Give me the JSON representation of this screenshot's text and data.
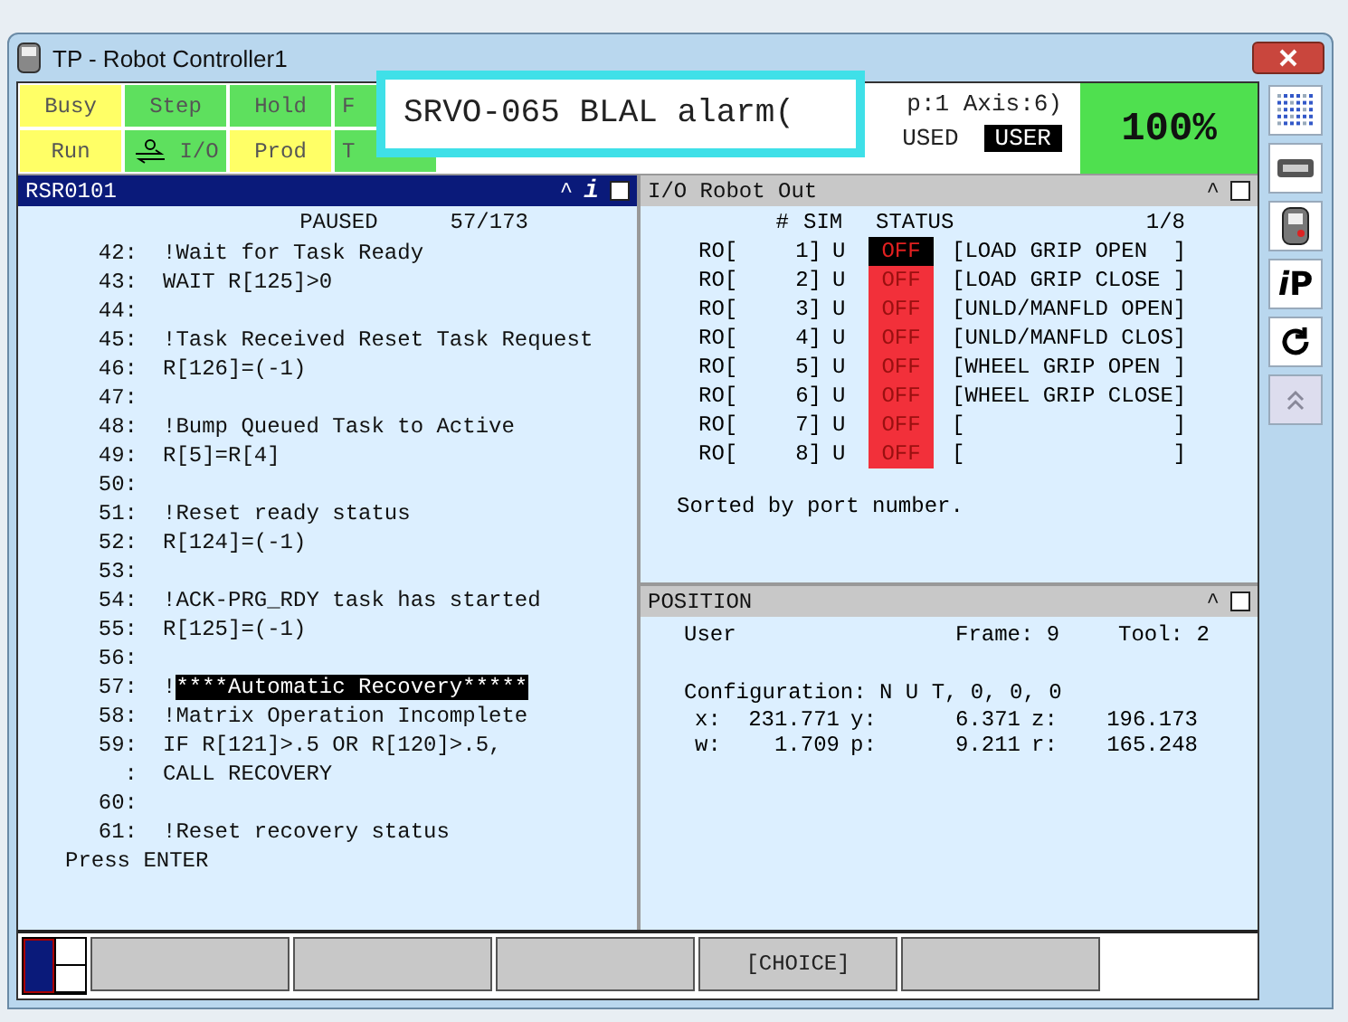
{
  "window": {
    "title": "TP - Robot Controller1"
  },
  "status_keys": [
    {
      "label": "Busy",
      "color": "#ffff66"
    },
    {
      "label": "Step",
      "color": "#5ee05e"
    },
    {
      "label": "Hold",
      "color": "#5ee05e"
    },
    {
      "label": "F",
      "color": "#5ee05e"
    },
    {
      "label": "Run",
      "color": "#ffff66"
    },
    {
      "label": "I/O",
      "color": "#5ee05e",
      "icon": true
    },
    {
      "label": "Prod",
      "color": "#ffff66"
    },
    {
      "label": "T",
      "color": "#5ee05e"
    }
  ],
  "status_info": {
    "line1": "p:1 Axis:6)",
    "line2": "USED",
    "mode": "USER"
  },
  "override": "100%",
  "alarm": "SRVO-065 BLAL alarm(",
  "program": {
    "title": "RSR0101",
    "controls": [
      "^",
      "i"
    ],
    "state": "PAUSED",
    "position": "57/173",
    "lines": [
      {
        "num": "42:",
        "text": "!Wait for Task Ready"
      },
      {
        "num": "43:",
        "text": "WAIT R[125]>0"
      },
      {
        "num": "44:"
      },
      {
        "num": "45:",
        "text": "!Task Received Reset Task Request"
      },
      {
        "num": "46:",
        "text": "R[126]=(-1)"
      },
      {
        "num": "47:"
      },
      {
        "num": "48:",
        "text": "!Bump Queued Task to Active"
      },
      {
        "num": "49:",
        "text": "R[5]=R[4]"
      },
      {
        "num": "50:"
      },
      {
        "num": "51:",
        "text": "!Reset ready status"
      },
      {
        "num": "52:",
        "text": "R[124]=(-1)"
      },
      {
        "num": "53:"
      },
      {
        "num": "54:",
        "text": "!ACK-PRG_RDY task has started"
      },
      {
        "num": "55:",
        "text": "R[125]=(-1)"
      },
      {
        "num": "56:"
      },
      {
        "num": "57:",
        "text": "!",
        "highlight": "****Automatic Recovery*****"
      },
      {
        "num": "58:",
        "text": "!Matrix Operation Incomplete"
      },
      {
        "num": "59:",
        "text": "IF R[121]>.5 OR R[120]>.5,"
      },
      {
        "num": ":",
        "text": "CALL RECOVERY"
      },
      {
        "num": "60:"
      },
      {
        "num": "61:",
        "text": "!Reset recovery status"
      }
    ],
    "prompt": "Press ENTER"
  },
  "io": {
    "title": "I/O Robot Out",
    "controls": [
      "^"
    ],
    "columns": [
      "#",
      "SIM",
      "STATUS"
    ],
    "page": "1/8",
    "rows": [
      {
        "type": "RO[",
        "port": "1]",
        "sim": "U",
        "status": "OFF",
        "on": false,
        "comment": "[LOAD GRIP OPEN  ]",
        "selected": true
      },
      {
        "type": "RO[",
        "port": "2]",
        "sim": "U",
        "status": "OFF",
        "on": false,
        "comment": "[LOAD GRIP CLOSE ]",
        "selected": false
      },
      {
        "type": "RO[",
        "port": "3]",
        "sim": "U",
        "status": "OFF",
        "on": false,
        "comment": "[UNLD/MANFLD OPEN]",
        "selected": false
      },
      {
        "type": "RO[",
        "port": "4]",
        "sim": "U",
        "status": "OFF",
        "on": false,
        "comment": "[UNLD/MANFLD CLOS]",
        "selected": false
      },
      {
        "type": "RO[",
        "port": "5]",
        "sim": "U",
        "status": "OFF",
        "on": false,
        "comment": "[WHEEL GRIP OPEN ]",
        "selected": false
      },
      {
        "type": "RO[",
        "port": "6]",
        "sim": "U",
        "status": "OFF",
        "on": false,
        "comment": "[WHEEL GRIP CLOSE]",
        "selected": false
      },
      {
        "type": "RO[",
        "port": "7]",
        "sim": "U",
        "status": "OFF",
        "on": false,
        "comment": "[                ]",
        "selected": false
      },
      {
        "type": "RO[",
        "port": "8]",
        "sim": "U",
        "status": "OFF",
        "on": false,
        "comment": "[                ]",
        "selected": false
      }
    ],
    "note": "Sorted by port number."
  },
  "position": {
    "title": "POSITION",
    "controls": [
      "^"
    ],
    "frame_type": "User",
    "frame": "Frame: 9",
    "tool": "Tool: 2",
    "configuration": "Configuration: N U T, 0, 0, 0",
    "values": [
      [
        "x:",
        "231.771",
        "y:",
        "6.371",
        "z:",
        "196.173"
      ],
      [
        "w:",
        "1.709",
        "p:",
        "9.211",
        "r:",
        "165.248"
      ]
    ]
  },
  "function_keys": [
    {
      "kind": "blank"
    },
    {
      "kind": "blank"
    },
    {
      "kind": "blank"
    },
    {
      "kind": "label",
      "label": "[CHOICE]"
    },
    {
      "kind": "blank"
    }
  ],
  "sidebar": {
    "ip_button": [
      "i",
      "P"
    ]
  }
}
